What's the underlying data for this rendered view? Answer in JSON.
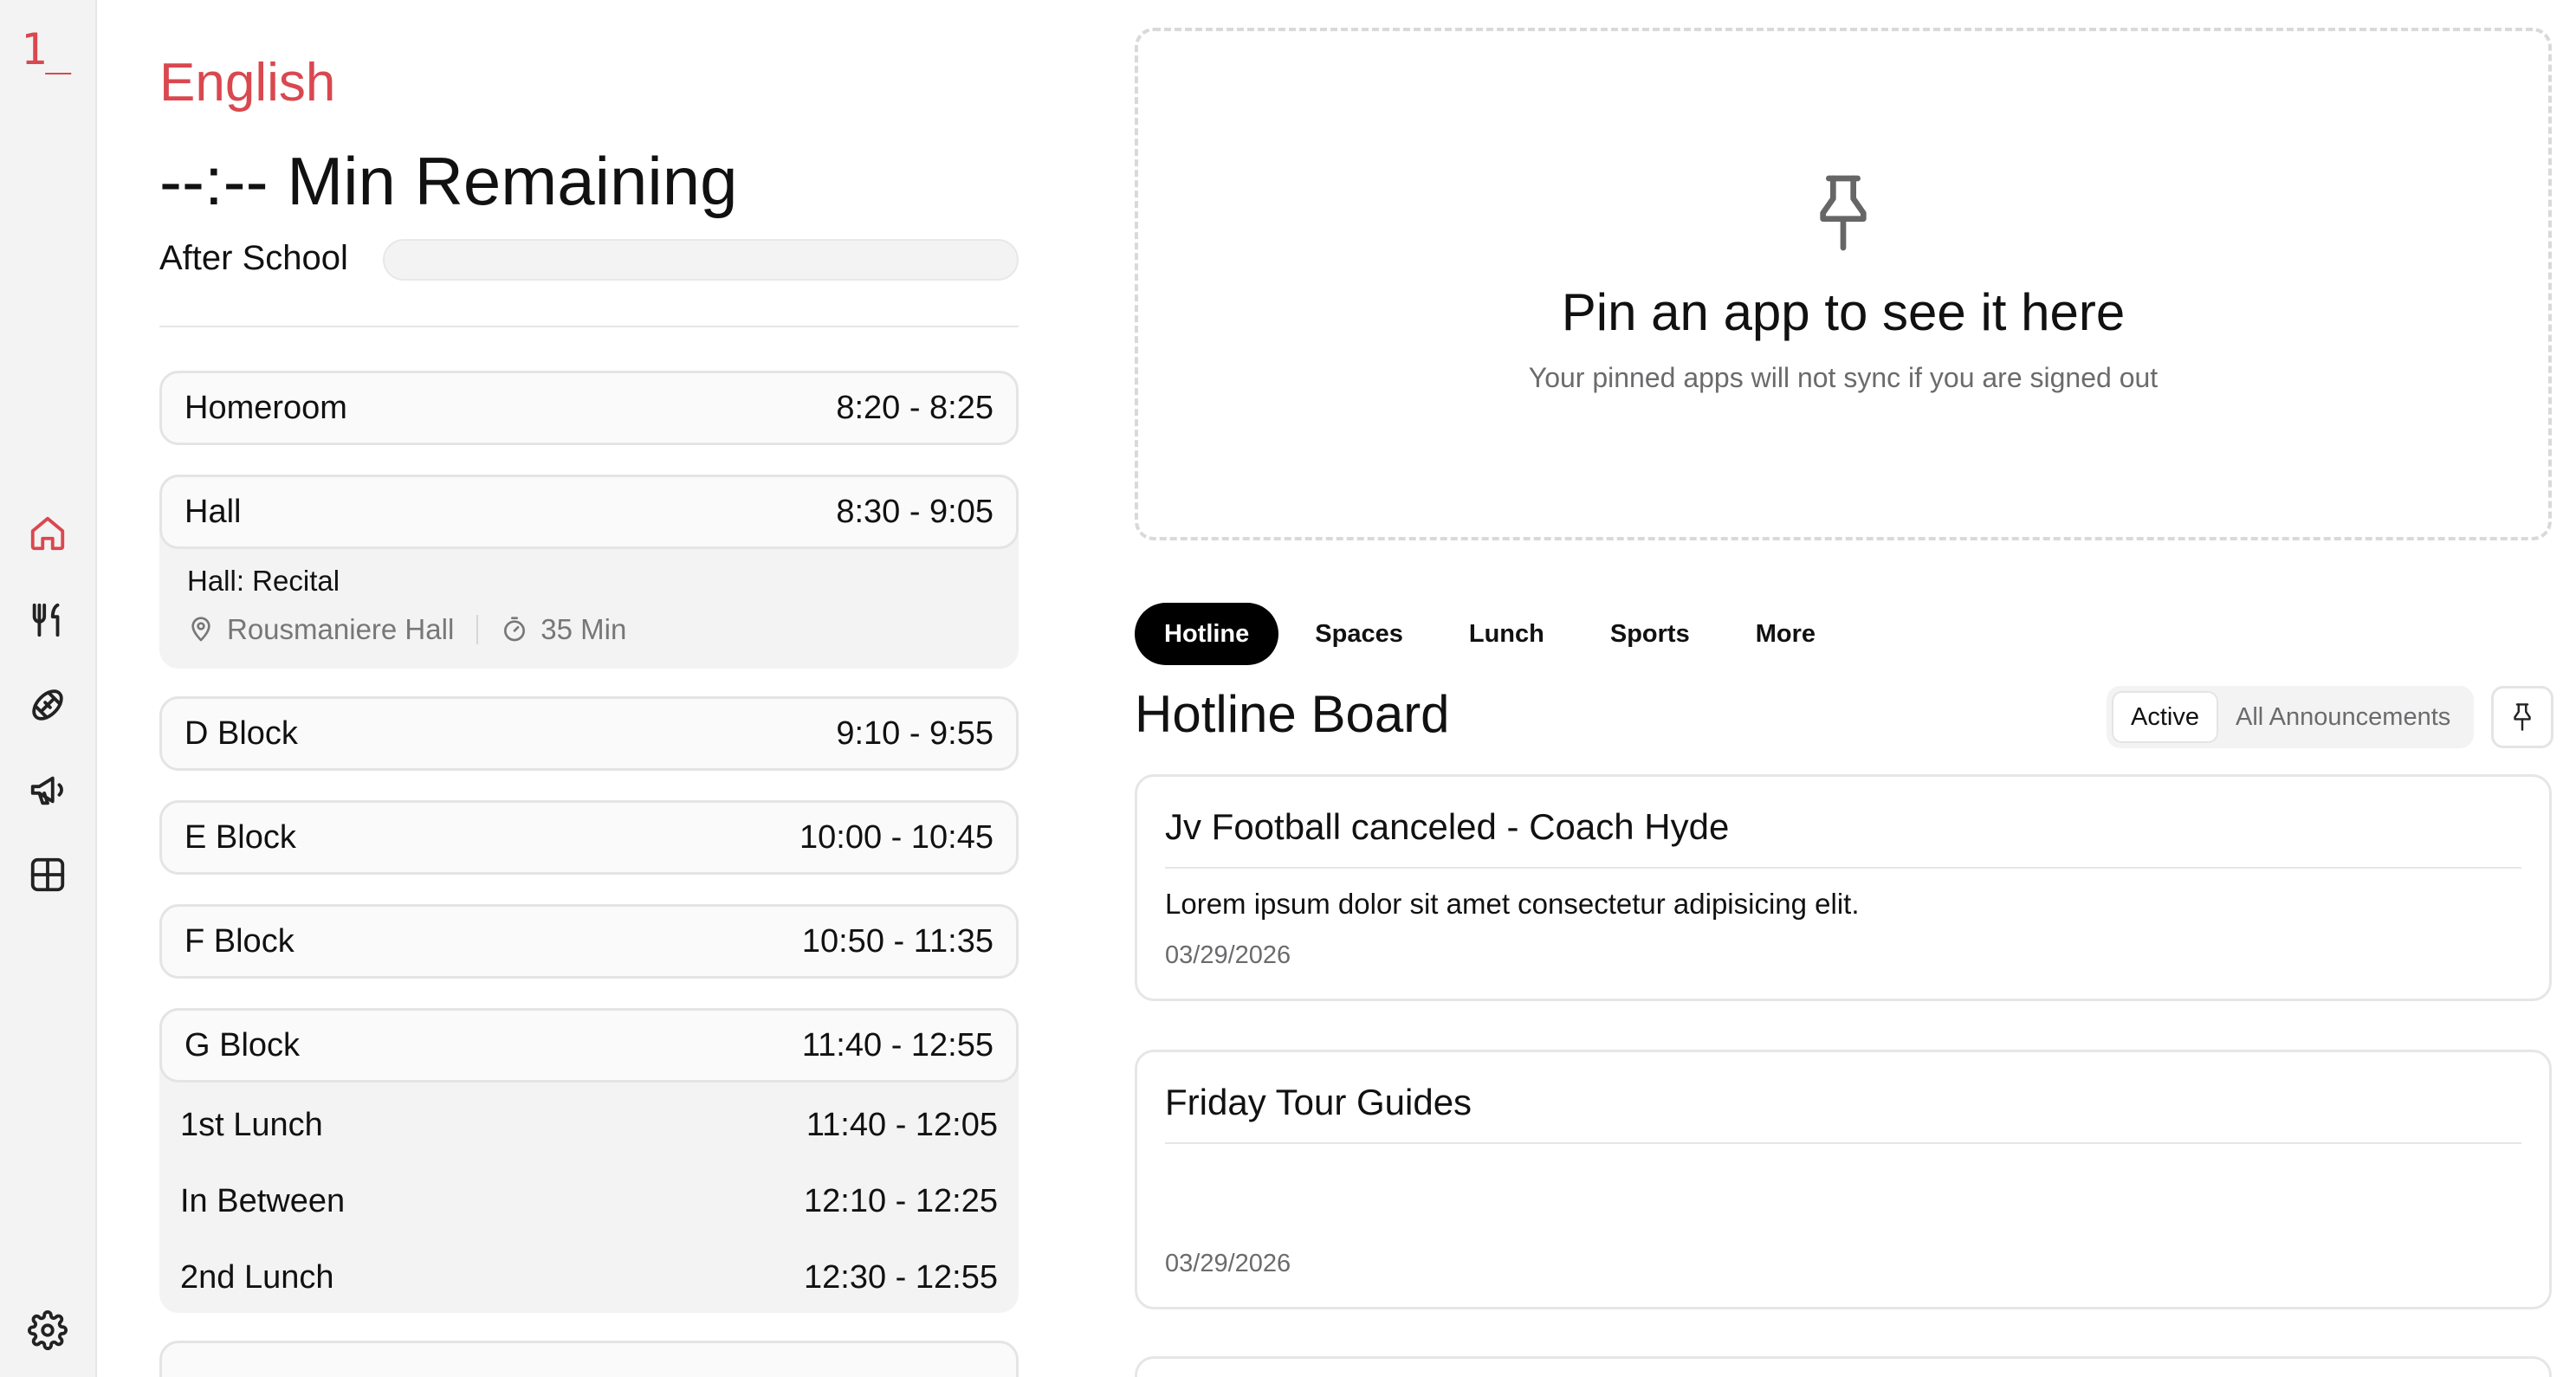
{
  "sidebar": {
    "logo": "1_",
    "items": [
      {
        "name": "home",
        "icon": "home-icon",
        "active": true
      },
      {
        "name": "lunch",
        "icon": "utensils-icon"
      },
      {
        "name": "sports",
        "icon": "football-icon"
      },
      {
        "name": "announcements",
        "icon": "megaphone-icon"
      },
      {
        "name": "apps",
        "icon": "grid-icon"
      }
    ],
    "settings_icon": "gear-icon"
  },
  "schedule": {
    "current_class": "English",
    "remaining": "--:-- Min Remaining",
    "next_label": "After School",
    "progress": 0,
    "periods": [
      {
        "name": "Homeroom",
        "time": "8:20 - 8:25"
      },
      {
        "name": "Hall",
        "time": "8:30 - 9:05",
        "detail": {
          "title": "Hall: Recital",
          "location": "Rousmaniere Hall",
          "duration": "35 Min"
        }
      },
      {
        "name": "D Block",
        "time": "9:10 - 9:55"
      },
      {
        "name": "E Block",
        "time": "10:00 - 10:45"
      },
      {
        "name": "F Block",
        "time": "10:50 - 11:35"
      },
      {
        "name": "G Block",
        "time": "11:40 - 12:55",
        "sub": [
          {
            "name": "1st Lunch",
            "time": "11:40 - 12:05"
          },
          {
            "name": "In Between",
            "time": "12:10 - 12:25"
          },
          {
            "name": "2nd Lunch",
            "time": "12:30 - 12:55"
          }
        ]
      }
    ]
  },
  "pinned": {
    "title": "Pin an app to see it here",
    "subtitle": "Your pinned apps will not sync if you are signed out"
  },
  "tabs": [
    "Hotline",
    "Spaces",
    "Lunch",
    "Sports",
    "More"
  ],
  "board": {
    "title": "Hotline Board",
    "filter_active": "Active",
    "filter_all": "All Announcements",
    "cards": [
      {
        "title": "Jv Football canceled - Coach Hyde",
        "body": "Lorem ipsum dolor sit amet consectetur adipisicing elit.",
        "date": "03/29/2026"
      },
      {
        "title": "Friday Tour Guides",
        "body": "",
        "date": "03/29/2026"
      }
    ]
  },
  "colors": {
    "accent": "#d9484f",
    "tab_active_bg": "#000000",
    "muted": "#6b6b6e"
  }
}
